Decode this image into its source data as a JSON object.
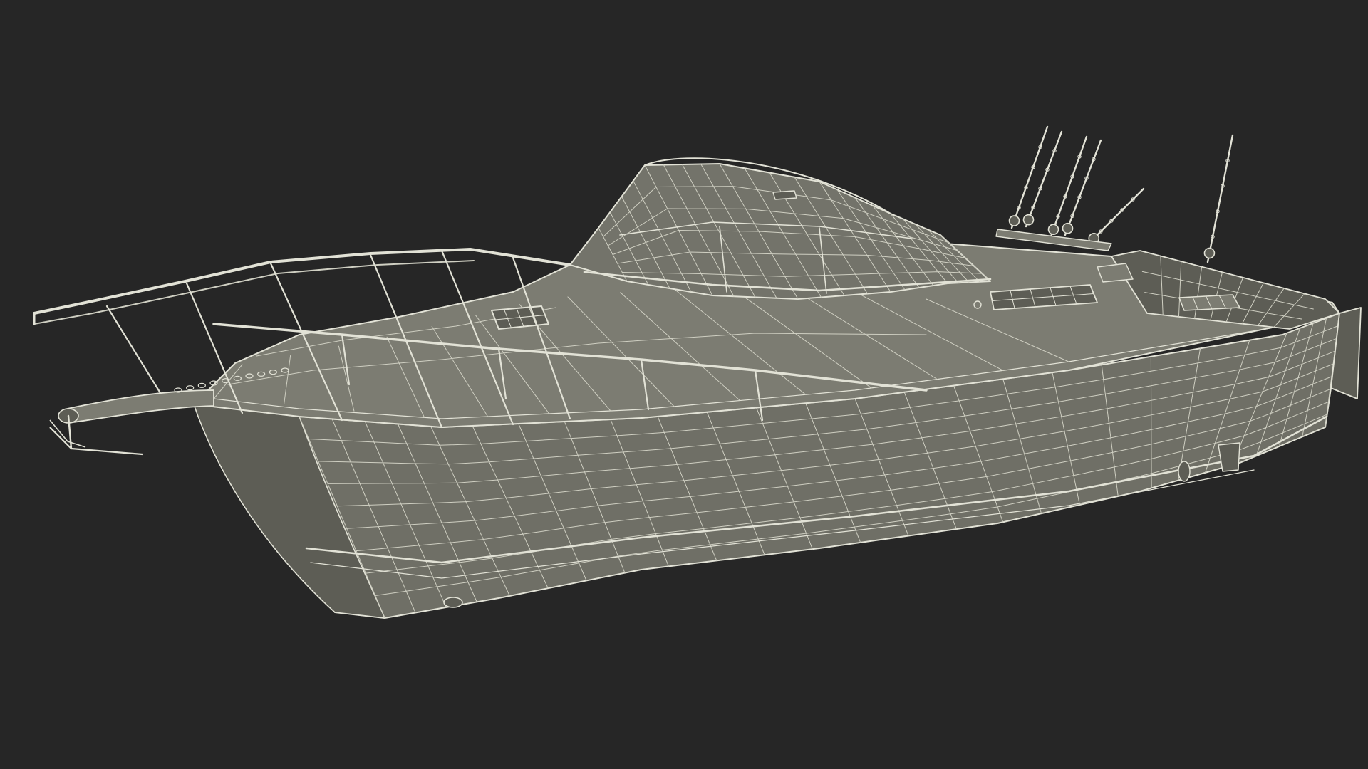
{
  "scene": {
    "subject": "boat-wireframe-render",
    "icons": [
      "boat-hull",
      "cabin-windshield",
      "bow-railing",
      "fishing-rod",
      "anchor",
      "deck-hatch"
    ]
  },
  "colors": {
    "background": "#262626",
    "hull_fill": "#6f6f66",
    "hull_shadow": "#5d5d55",
    "deck_fill": "#7c7c72",
    "cabin_fill": "#73736a",
    "wire": "#e2e2d6",
    "wire_dim": "#cfcfc2"
  }
}
